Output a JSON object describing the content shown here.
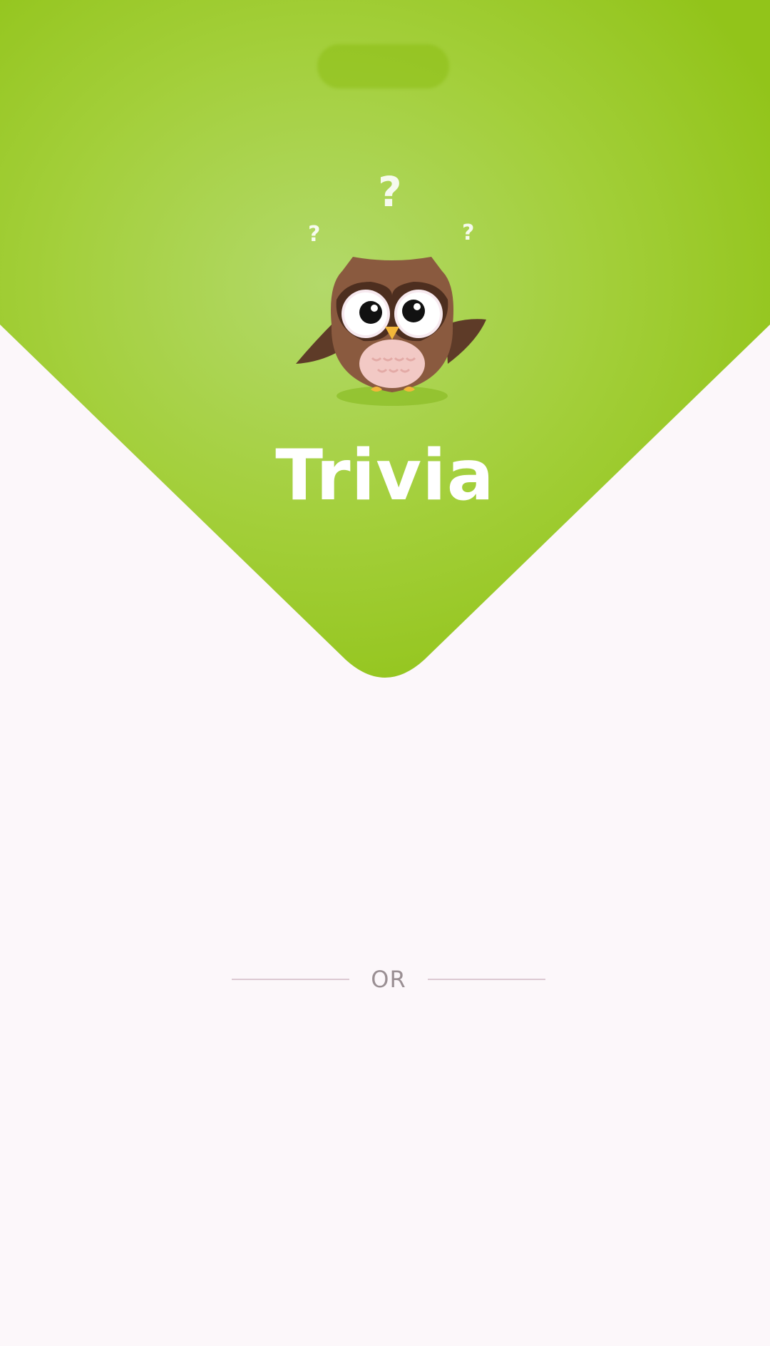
{
  "app": {
    "title": "Trivia"
  },
  "hero": {
    "question_marks": [
      "?",
      "?",
      "?"
    ],
    "mascot_icon": "owl-mascot-icon"
  },
  "divider": {
    "label": "OR"
  },
  "colors": {
    "brand_green": "#9bc925",
    "brand_green_light": "#b3d96a",
    "background": "#fcf7fa",
    "owl_brown": "#8a5a3f",
    "divider_line": "#dcc9d2",
    "divider_text": "#9a8f93"
  }
}
